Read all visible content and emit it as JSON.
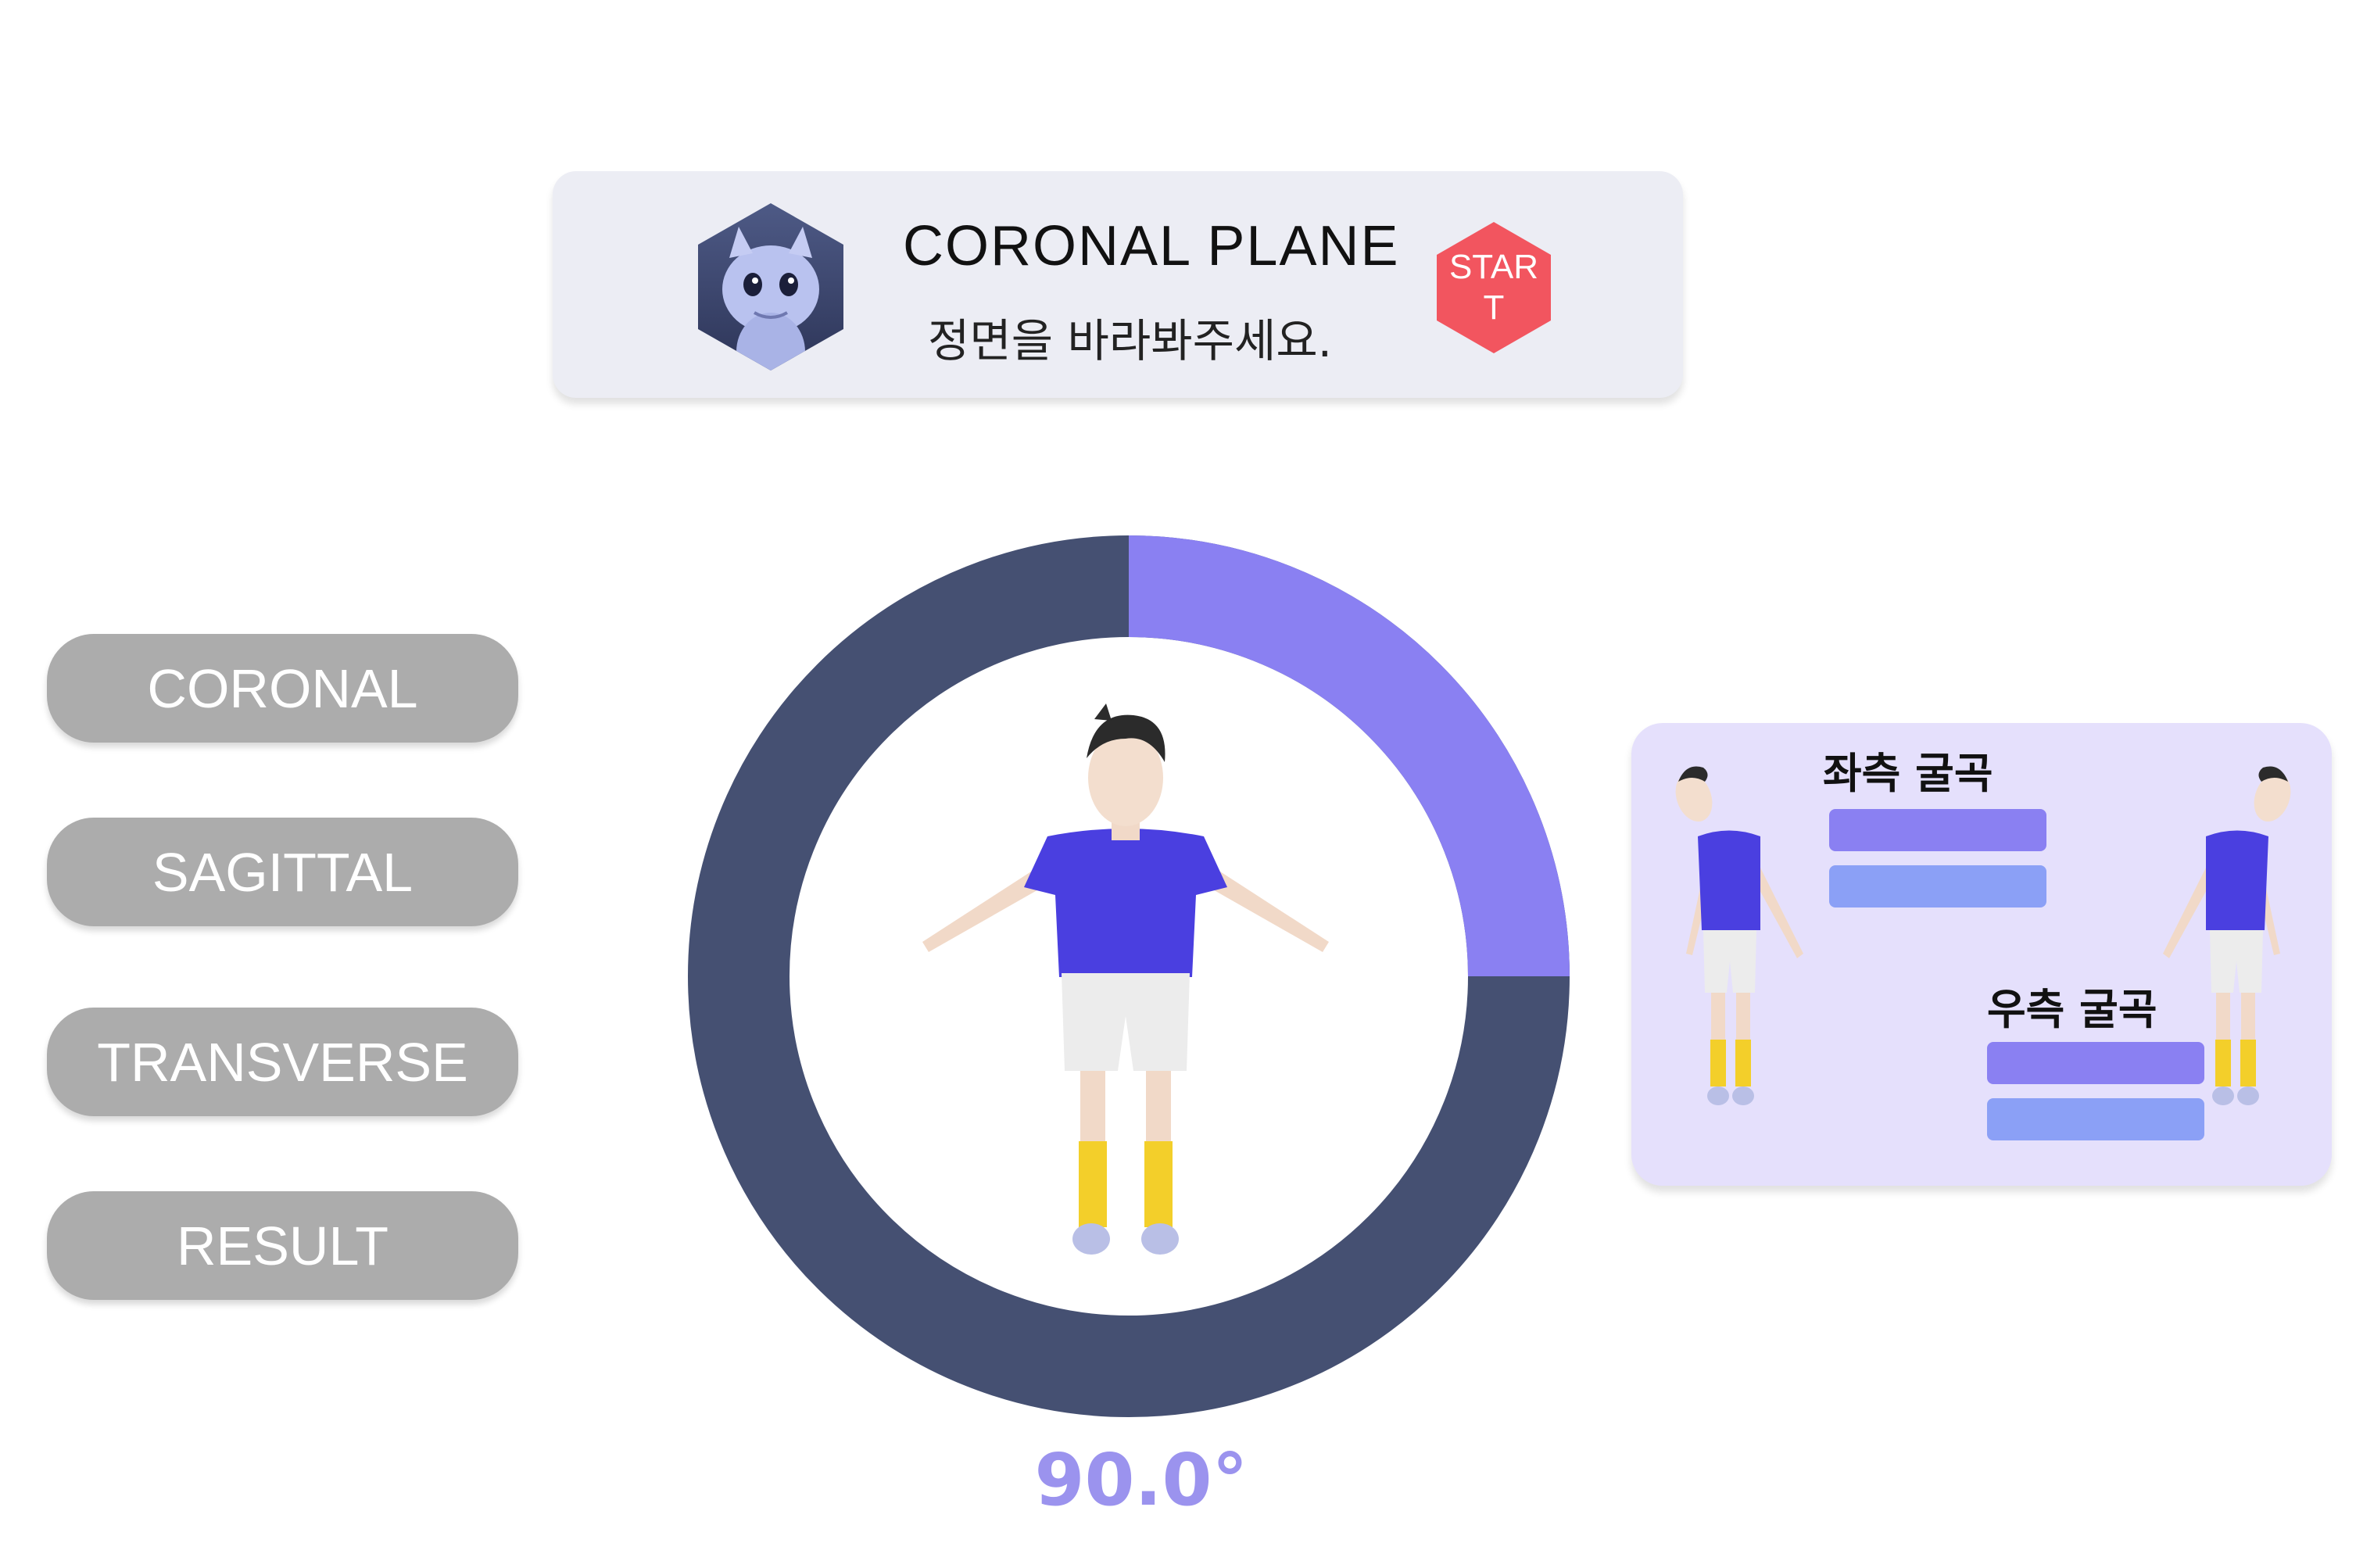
{
  "header": {
    "title": "CORONAL PLANE",
    "subtitle": "정면을 바라봐주세요.",
    "start_label": "START",
    "avatar_icon": "creature-avatar-icon"
  },
  "nav": {
    "items": [
      {
        "label": "CORONAL"
      },
      {
        "label": "SAGITTAL"
      },
      {
        "label": "TRANSVERSE"
      },
      {
        "label": "RESULT"
      }
    ]
  },
  "gauge": {
    "value_text": "90.0°",
    "angle_degrees": 90,
    "progress_fraction": 0.25,
    "progress_color": "#8a80f2",
    "track_color": "#455072"
  },
  "reference": {
    "left_bend_label": "좌측 굴곡",
    "right_bend_label": "우측 굴곡"
  },
  "colors": {
    "nav_button": "#acacac",
    "start_button": "#f2555f",
    "header_card": "#ecedf4",
    "panel": "#e5e0fc"
  }
}
